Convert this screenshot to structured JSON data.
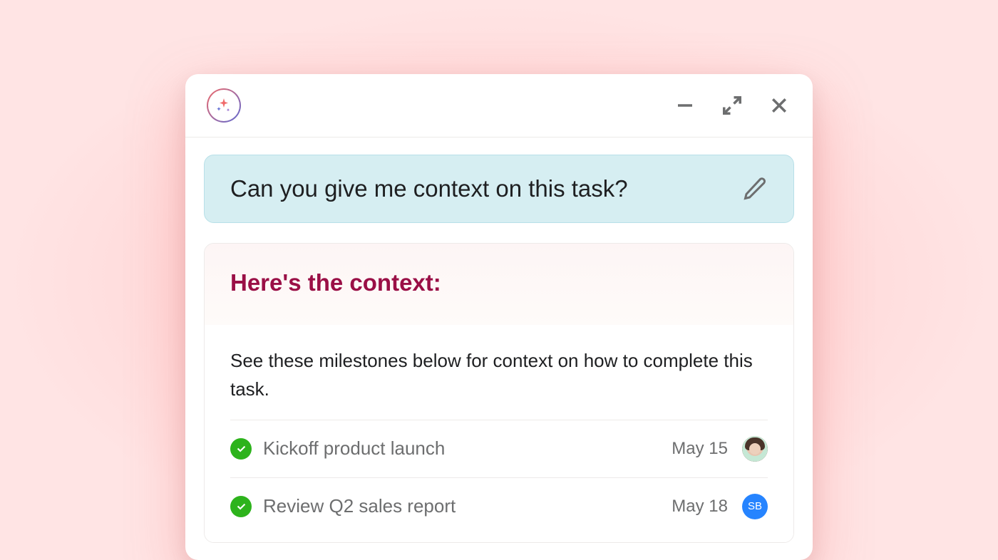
{
  "prompt": {
    "text": "Can you give me context on this task?"
  },
  "response": {
    "title": "Here's the context:",
    "description": "See these milestones below for context on how to complete this task."
  },
  "milestones": [
    {
      "title": "Kickoff product launch",
      "date": "May 15",
      "avatar_type": "photo",
      "avatar_initials": ""
    },
    {
      "title": "Review Q2 sales report",
      "date": "May 18",
      "avatar_type": "initials",
      "avatar_initials": "SB"
    }
  ]
}
